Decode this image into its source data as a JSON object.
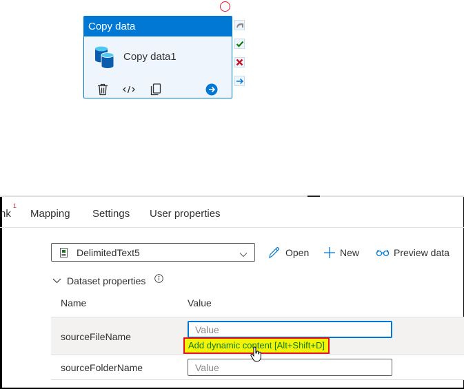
{
  "canvas": {
    "activity": {
      "type_label": "Copy data",
      "name": "Copy data1",
      "icon": "database-icon",
      "actions": [
        "delete-icon",
        "code-icon",
        "copy-icon",
        "go-arrow-icon"
      ]
    },
    "handles": [
      "skip-icon",
      "success-check-icon",
      "failure-x-icon",
      "completion-arrow-icon"
    ]
  },
  "tabs": [
    {
      "label": "nk",
      "badge": "1"
    },
    {
      "label": "Mapping"
    },
    {
      "label": "Settings"
    },
    {
      "label": "User properties"
    }
  ],
  "dataset": {
    "selected": "DelimitedText5",
    "actions": {
      "open": "Open",
      "new": "New",
      "preview": "Preview data"
    }
  },
  "dataset_properties": {
    "title": "Dataset properties",
    "columns": {
      "name": "Name",
      "value": "Value"
    },
    "rows": [
      {
        "name": "sourceFileName",
        "value": "",
        "placeholder": "Value"
      },
      {
        "name": "sourceFolderName",
        "value": "",
        "placeholder": "Value"
      }
    ],
    "dynamic_content_link": "Add dynamic content [Alt+Shift+D]"
  },
  "colors": {
    "accent": "#0078d4",
    "highlight_bg": "#f2f20a",
    "highlight_border": "#e81123",
    "link_text": "#107c10"
  }
}
